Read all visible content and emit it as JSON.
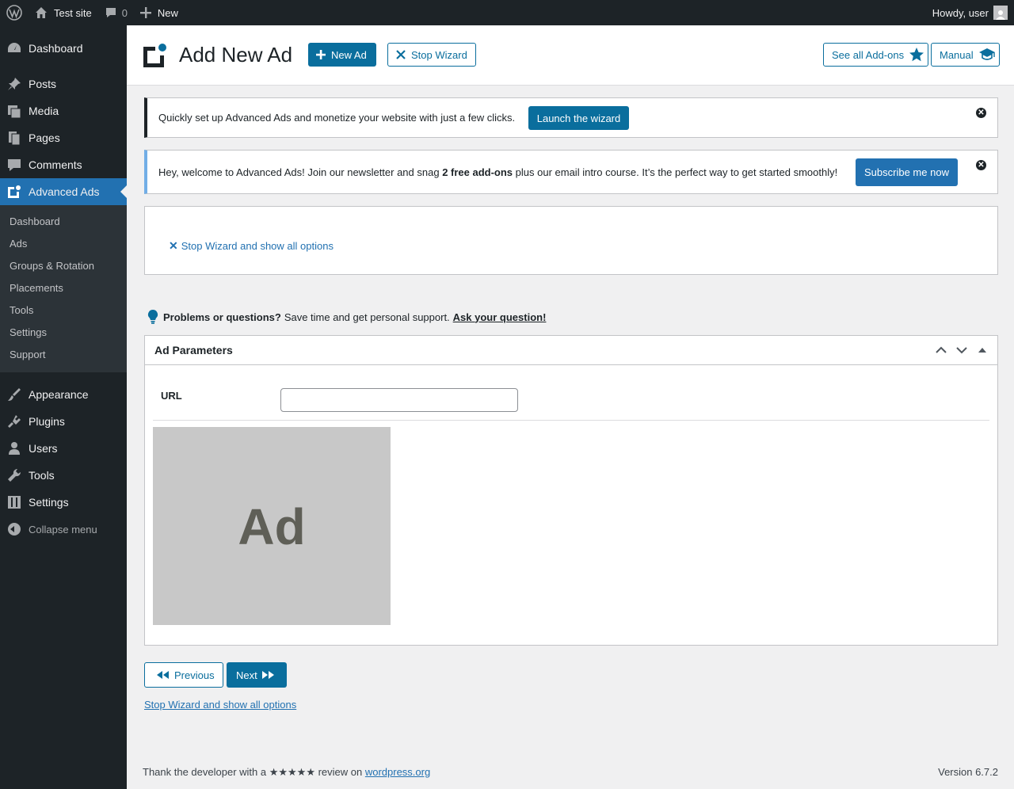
{
  "adminbar": {
    "site_name": "Test site",
    "comments_count": "0",
    "new_label": "New",
    "greeting": "Howdy, user"
  },
  "sidebar": {
    "items": [
      {
        "label": "Dashboard",
        "icon": "dashboard-icon"
      },
      {
        "label": "Posts",
        "icon": "pin-icon"
      },
      {
        "label": "Media",
        "icon": "media-icon"
      },
      {
        "label": "Pages",
        "icon": "pages-icon"
      },
      {
        "label": "Comments",
        "icon": "comment-icon"
      },
      {
        "label": "Advanced Ads",
        "icon": "advanced-ads-icon",
        "current": true
      },
      {
        "label": "Appearance",
        "icon": "brush-icon"
      },
      {
        "label": "Plugins",
        "icon": "plug-icon"
      },
      {
        "label": "Users",
        "icon": "user-icon"
      },
      {
        "label": "Tools",
        "icon": "wrench-icon"
      },
      {
        "label": "Settings",
        "icon": "settings-icon"
      }
    ],
    "submenu": [
      "Dashboard",
      "Ads",
      "Groups & Rotation",
      "Placements",
      "Tools",
      "Settings",
      "Support"
    ],
    "collapse_label": "Collapse menu"
  },
  "header": {
    "title": "Add New Ad",
    "new_ad_label": "New Ad",
    "stop_wizard_label": "Stop Wizard",
    "addons_label": "See all Add-ons",
    "manual_label": "Manual"
  },
  "notices": {
    "wizard_text": "Quickly set up Advanced Ads and monetize your website with just a few clicks.",
    "wizard_button": "Launch the wizard",
    "news_text_1": "Hey, welcome to Advanced Ads! Join our newsletter and snag ",
    "news_bold": "2 free add-ons",
    "news_text_2": " plus our email intro course. It’s the perfect way to get started smoothly!",
    "news_button": "Subscribe me now"
  },
  "wizard_box": {
    "stop_link": "Stop Wizard and show all options"
  },
  "support": {
    "bold": "Problems or questions?",
    "text": "Save time and get personal support.",
    "link": "Ask your question!"
  },
  "ad_parameters": {
    "title": "Ad Parameters",
    "url_label": "URL",
    "url_value": "",
    "image_text": "Ad"
  },
  "nav": {
    "previous": "Previous",
    "next": "Next",
    "stop_link": "Stop Wizard and show all options"
  },
  "footer": {
    "thanks": "Thank the developer with a ★★★★★ review on ",
    "link": "wordpress.org",
    "version": "Version 6.7.2"
  },
  "colors": {
    "accent": "#0a6e9d",
    "adminbar_bg": "#1d2327",
    "current_menu": "#2271b1"
  }
}
